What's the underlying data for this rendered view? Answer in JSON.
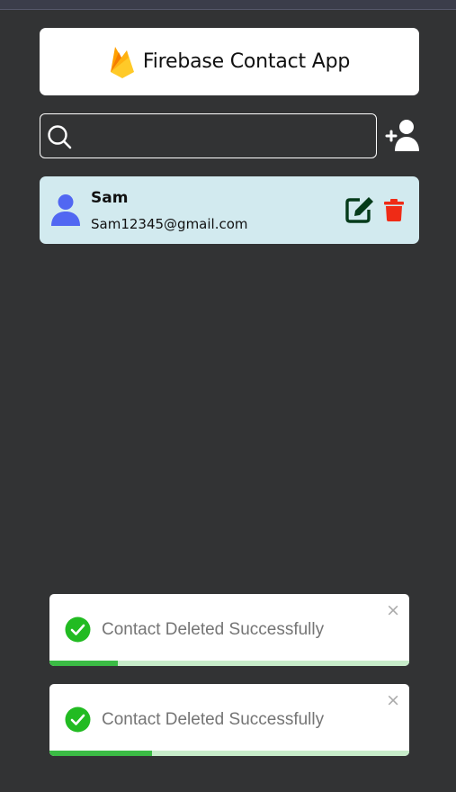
{
  "app": {
    "title": "Firebase Contact App"
  },
  "search": {
    "value": "",
    "placeholder": ""
  },
  "contacts": [
    {
      "name": "Sam",
      "email": "Sam12345@gmail.com"
    }
  ],
  "toasts": [
    {
      "message": "Contact Deleted Successfully",
      "close": "×",
      "progress": 0.19
    },
    {
      "message": "Contact Deleted Successfully",
      "close": "×",
      "progress": 0.285
    }
  ],
  "icons": {
    "logo": "firebase-logo",
    "search": "search-icon",
    "add": "add-user-icon",
    "avatar": "user-icon",
    "edit": "edit-icon",
    "delete": "trash-icon",
    "success": "check-circle-icon"
  },
  "colors": {
    "background": "#323334",
    "card": "#d2eaef",
    "avatar": "#5167f2",
    "edit": "#053b1a",
    "delete": "#ef2b16",
    "success": "#22bb22",
    "progress": "#3bbc45",
    "progress_track": "#c7ecc9"
  }
}
